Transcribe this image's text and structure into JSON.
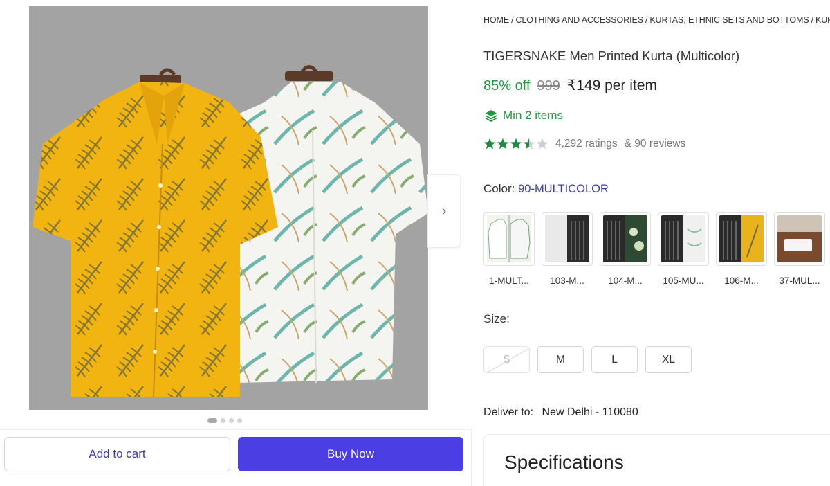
{
  "breadcrumb": [
    "HOME",
    "CLOTHING AND ACCESSORIES",
    "KURTAS, ETHNIC SETS AND BOTTOMS",
    "KURT"
  ],
  "product": {
    "title": "TIGERSNAKE Men Printed Kurta (Multicolor)",
    "discount": "85% off",
    "mrp": "999",
    "price": "₹149 per item",
    "min_items": "Min 2 items",
    "rating_value": 3.5,
    "ratings_count": "4,292 ratings",
    "reviews": "& 90 reviews"
  },
  "colors": {
    "accent_green": "#1f9a3e",
    "brand_blue": "#4b3fe4",
    "link_blue": "#3d3daa",
    "star_filled": "#1f8a3e",
    "star_empty": "#cfcfcf"
  },
  "gallery": {
    "next_icon": "chevron-right-icon",
    "slide_count": 4,
    "active_slide": 1
  },
  "color_selector": {
    "label": "Color:",
    "selected": "90-MULTICOLOR",
    "options": [
      "1-MULT...",
      "103-M...",
      "104-M...",
      "105-MU...",
      "106-M...",
      "37-MUL..."
    ]
  },
  "size_selector": {
    "label": "Size:",
    "options": [
      {
        "label": "S",
        "available": false
      },
      {
        "label": "M",
        "available": true
      },
      {
        "label": "L",
        "available": true
      },
      {
        "label": "XL",
        "available": true
      }
    ]
  },
  "delivery": {
    "label": "Deliver to:",
    "location": "New Delhi - 110080"
  },
  "specifications": {
    "title": "Specifications"
  },
  "actions": {
    "add_to_cart": "Add to cart",
    "buy_now": "Buy Now"
  }
}
